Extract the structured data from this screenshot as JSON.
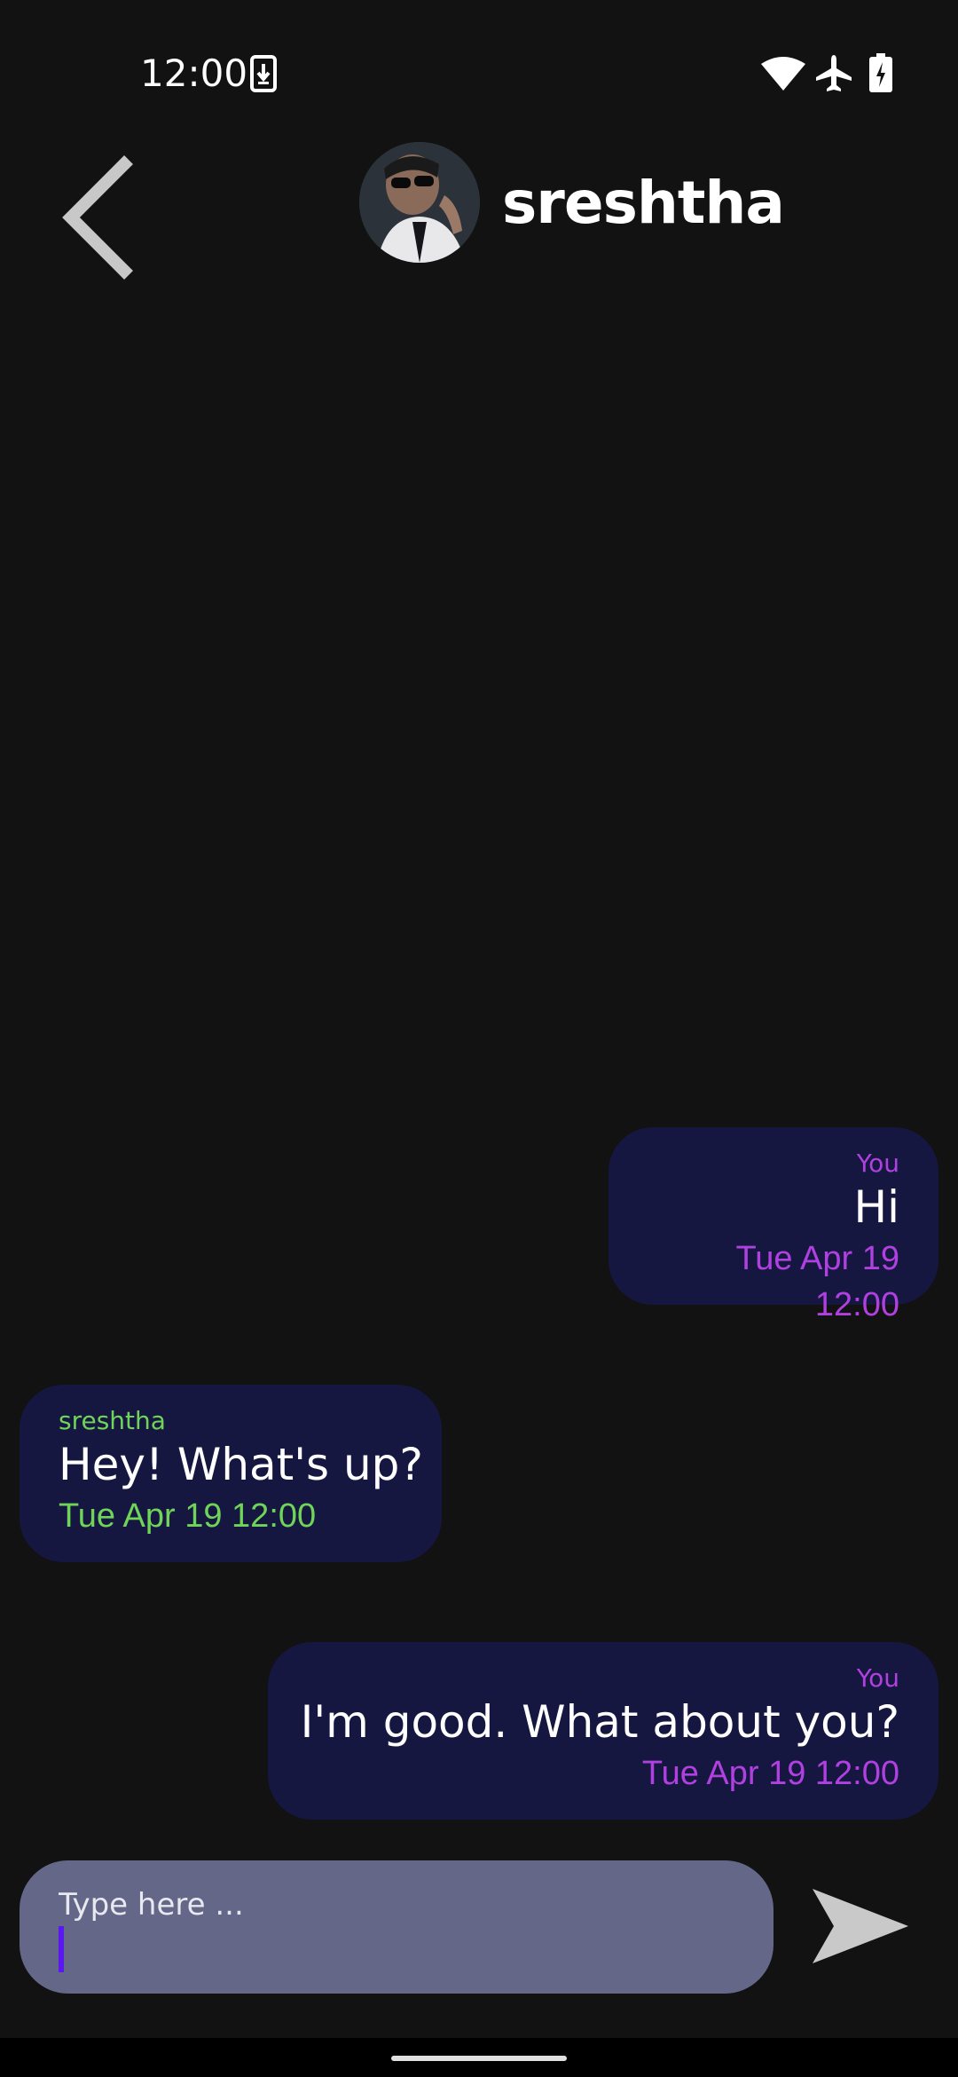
{
  "status_bar": {
    "time": "12:00",
    "icons": [
      "download-icon",
      "wifi-icon",
      "airplane-icon",
      "battery-charging-icon"
    ]
  },
  "header": {
    "contact_name": "sreshtha",
    "back_icon": "chevron-left-icon"
  },
  "messages": [
    {
      "direction": "sent",
      "sender": "You",
      "text": "Hi",
      "time": "Tue Apr 19 12:00"
    },
    {
      "direction": "received",
      "sender": "sreshtha",
      "text": "Hey! What's up?",
      "time": "Tue Apr 19 12:00"
    },
    {
      "direction": "sent",
      "sender": "You",
      "text": "I'm good. What about you?",
      "time": "Tue Apr 19 12:00"
    }
  ],
  "composer": {
    "placeholder": "Type here ...",
    "value": "",
    "send_icon": "send-icon"
  },
  "colors": {
    "background": "#121212",
    "bubble": "#161741",
    "sent_accent": "#b040e0",
    "received_accent": "#6fd457",
    "composer": "#656789",
    "caret": "#5a17f0"
  }
}
